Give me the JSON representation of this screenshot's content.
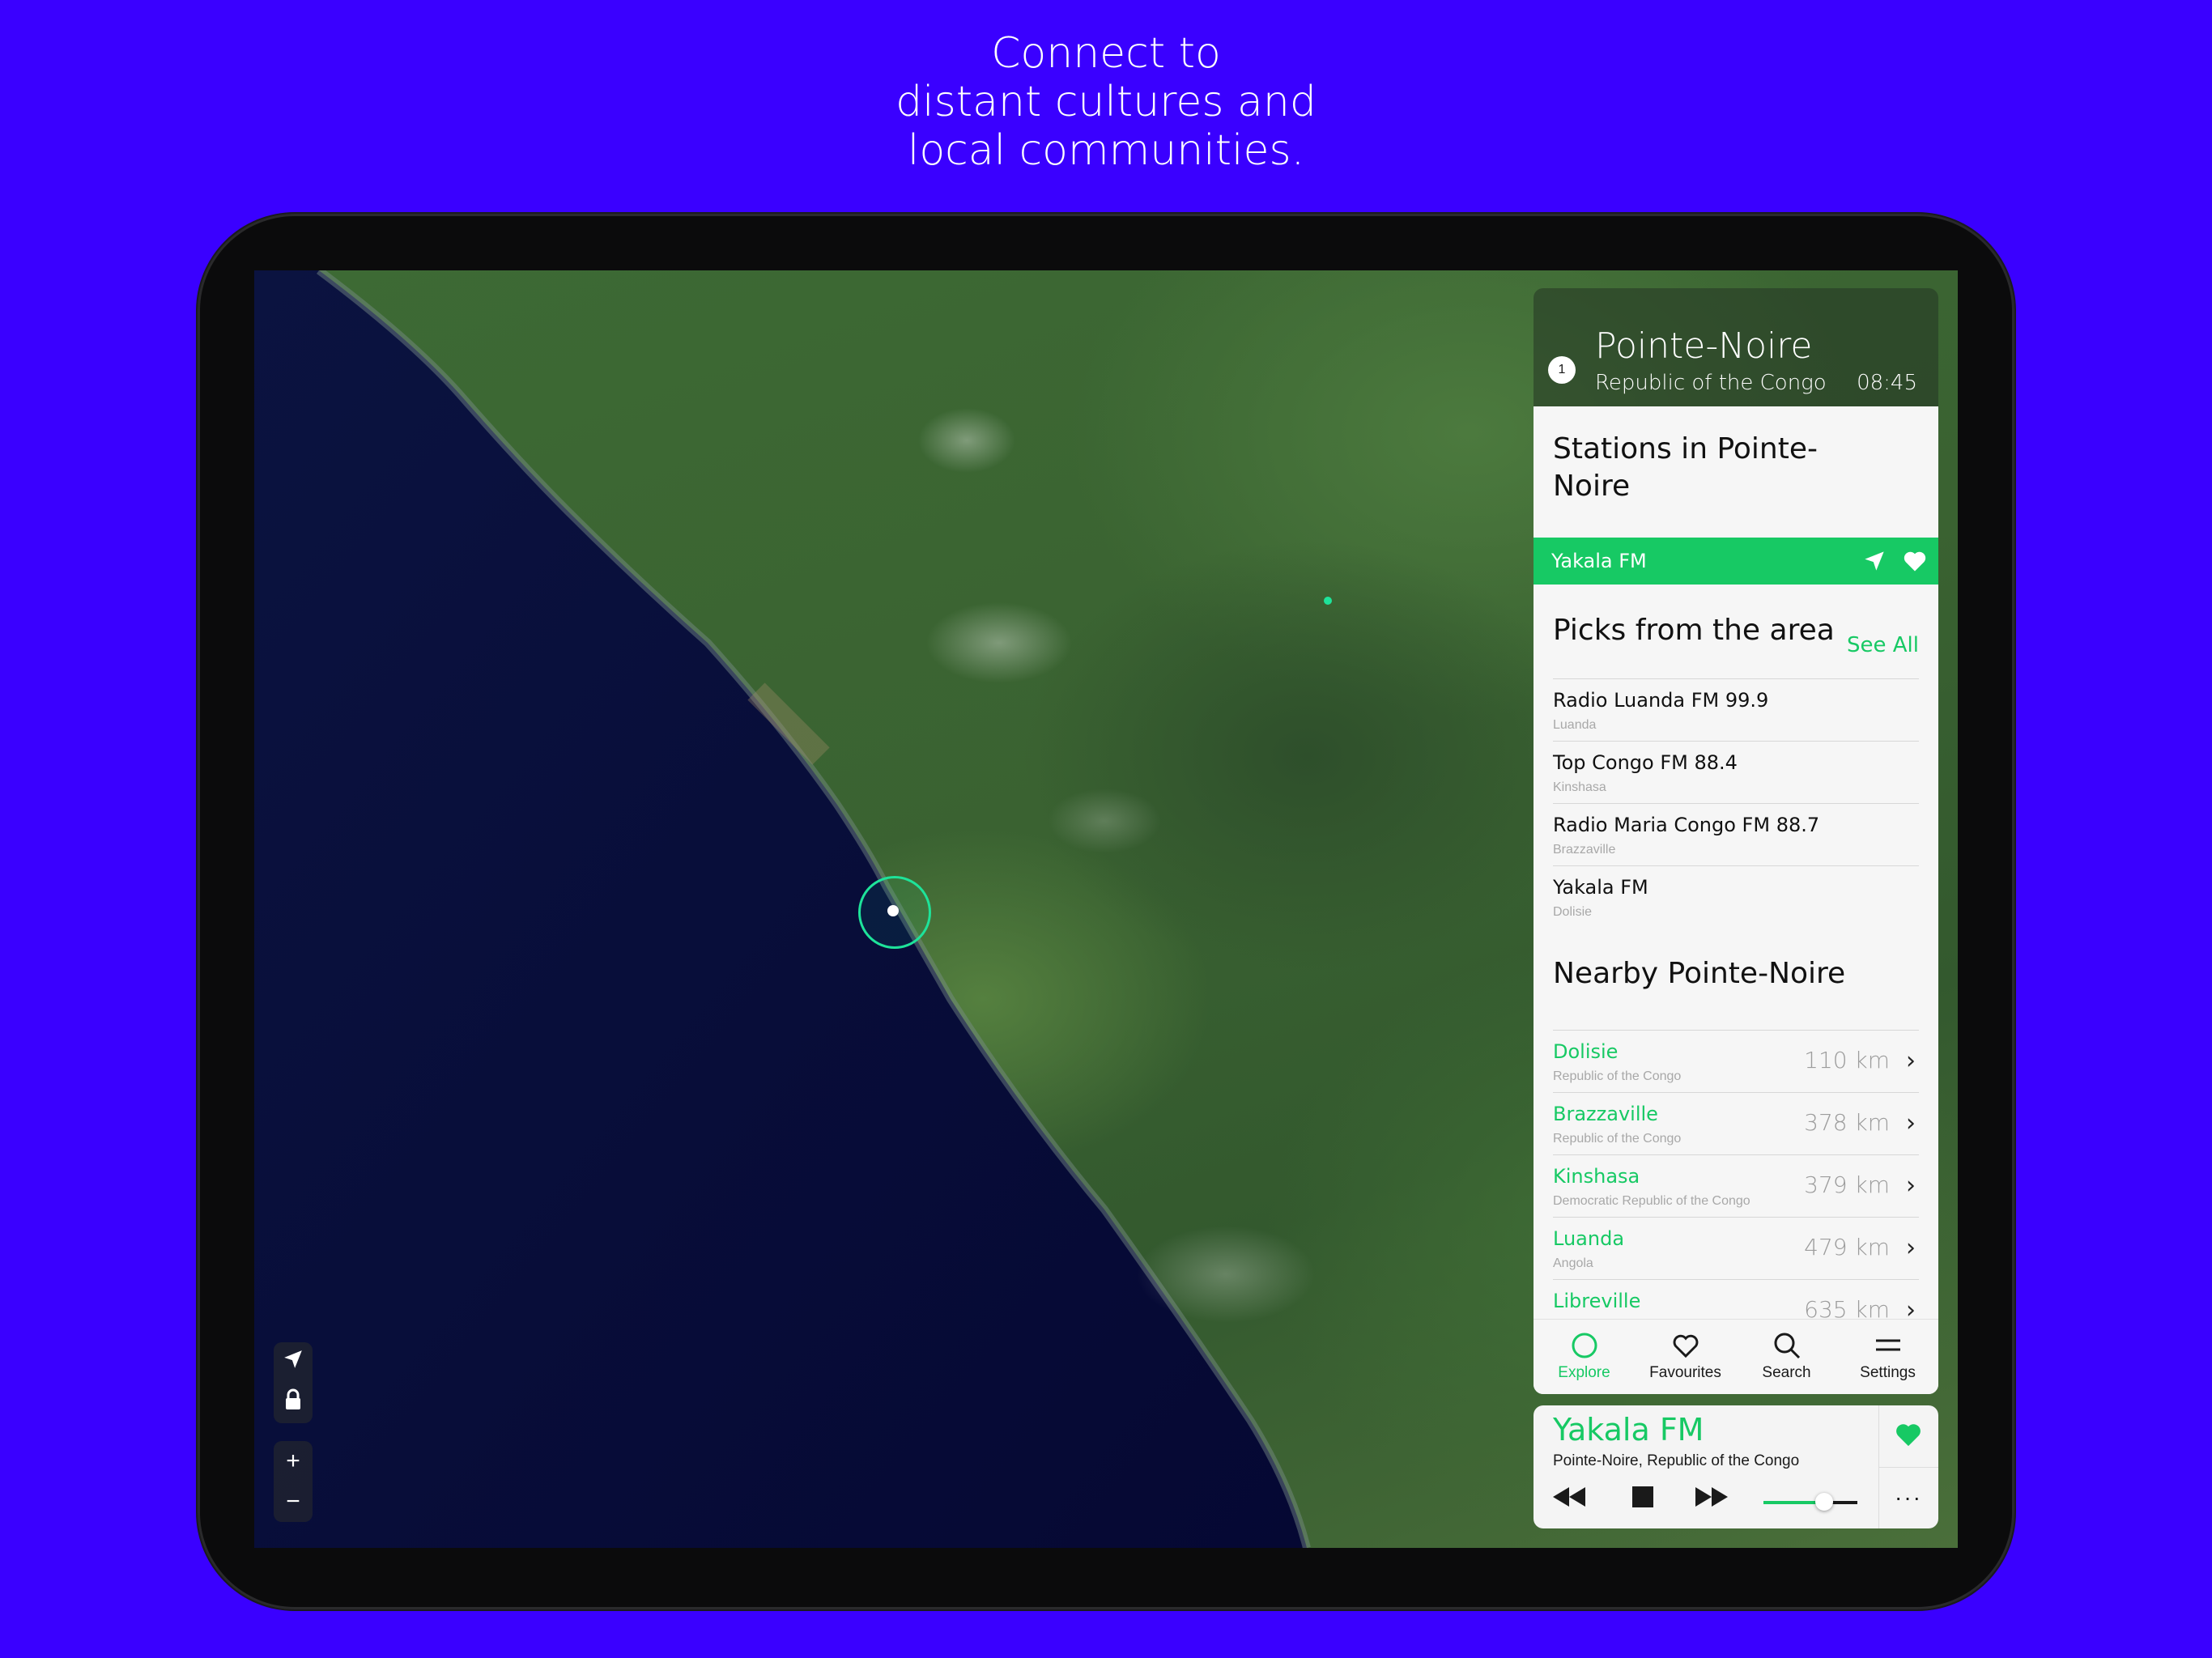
{
  "headline": {
    "line1": "Connect to",
    "line2": "distant cultures and",
    "line3": "local communities."
  },
  "location": {
    "badge": "1",
    "city": "Pointe-Noire",
    "country": "Republic of the Congo",
    "time": "08:45"
  },
  "stations": {
    "title": "Stations in Pointe-Noire",
    "current": "Yakala FM"
  },
  "picks": {
    "title": "Picks from the area",
    "see_all": "See All",
    "items": [
      {
        "name": "Radio Luanda FM 99.9",
        "city": "Luanda"
      },
      {
        "name": "Top Congo FM 88.4",
        "city": "Kinshasa"
      },
      {
        "name": "Radio Maria Congo FM 88.7",
        "city": "Brazzaville"
      },
      {
        "name": "Yakala FM",
        "city": "Dolisie"
      }
    ]
  },
  "nearby": {
    "title": "Nearby Pointe-Noire",
    "items": [
      {
        "name": "Dolisie",
        "country": "Republic of the Congo",
        "distance": "110 km"
      },
      {
        "name": "Brazzaville",
        "country": "Republic of the Congo",
        "distance": "378 km"
      },
      {
        "name": "Kinshasa",
        "country": "Democratic Republic of the Congo",
        "distance": "379 km"
      },
      {
        "name": "Luanda",
        "country": "Angola",
        "distance": "479 km"
      },
      {
        "name": "Libreville",
        "country": "",
        "distance": "635 km"
      }
    ]
  },
  "tabs": [
    {
      "label": "Explore",
      "icon": "circle-icon",
      "active": true
    },
    {
      "label": "Favourites",
      "icon": "heart-outline-icon",
      "active": false
    },
    {
      "label": "Search",
      "icon": "search-icon",
      "active": false
    },
    {
      "label": "Settings",
      "icon": "menu-icon",
      "active": false
    }
  ],
  "player": {
    "station": "Yakala FM",
    "location": "Pointe-Noire, Republic of the Congo",
    "volume": 0.65,
    "more": "···"
  },
  "map_controls": {
    "zoom_in": "+",
    "zoom_out": "−"
  },
  "colors": {
    "background": "#3a00ff",
    "accent": "#17c964",
    "ocean": "#06093a"
  }
}
